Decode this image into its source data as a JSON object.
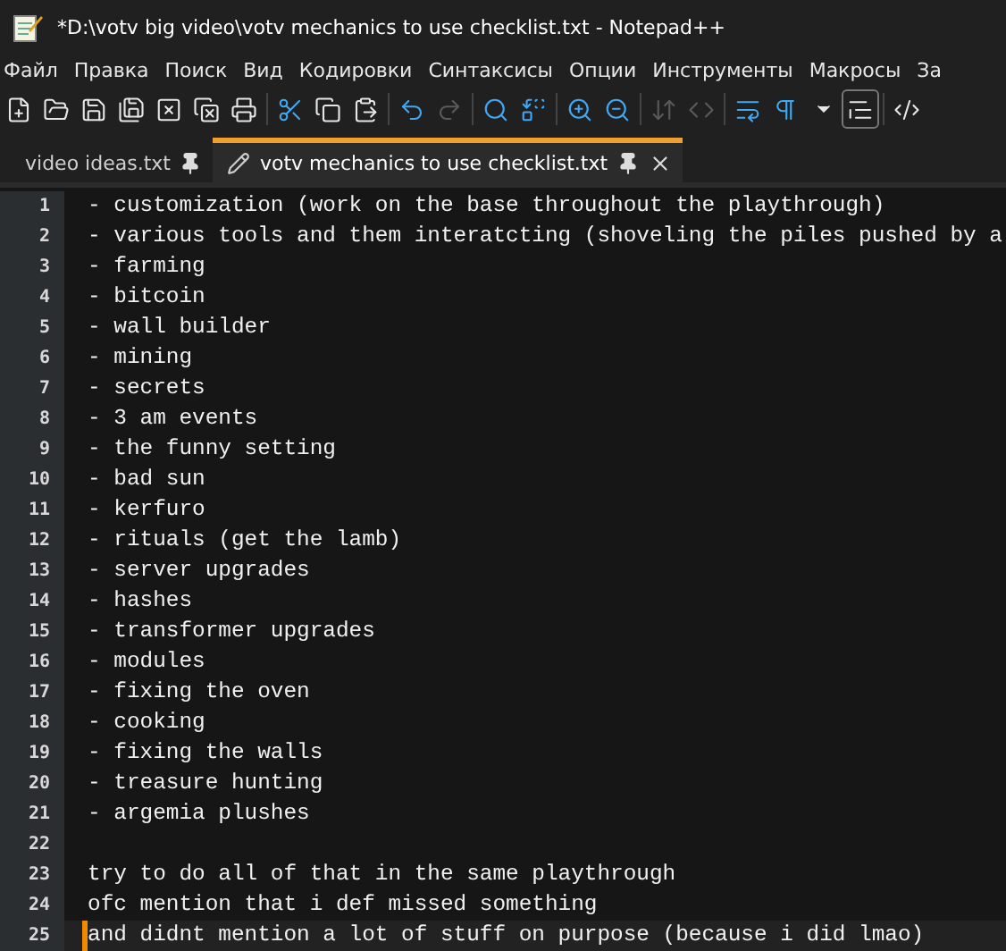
{
  "window": {
    "title": "*D:\\votv big video\\votv mechanics to use checklist.txt - Notepad++"
  },
  "menu": [
    "Файл",
    "Правка",
    "Поиск",
    "Вид",
    "Кодировки",
    "Синтаксисы",
    "Опции",
    "Инструменты",
    "Макросы",
    "За"
  ],
  "toolbar": [
    {
      "disabled": false,
      "selected": false
    },
    {
      "disabled": false,
      "selected": false
    },
    {
      "disabled": false,
      "selected": false
    },
    {
      "disabled": false,
      "selected": false
    },
    {
      "disabled": false,
      "selected": false
    },
    {
      "disabled": false,
      "selected": false
    },
    {
      "disabled": false,
      "selected": false
    },
    {
      "disabled": false,
      "selected": false
    },
    {
      "disabled": false,
      "selected": false
    },
    {
      "disabled": false,
      "selected": false
    },
    {
      "disabled": false,
      "selected": false
    },
    {
      "disabled": true,
      "selected": false
    },
    {
      "disabled": false,
      "selected": false
    },
    {
      "disabled": false,
      "selected": false
    },
    {
      "disabled": false,
      "selected": false
    },
    {
      "disabled": false,
      "selected": false
    },
    {
      "disabled": true,
      "selected": false
    },
    {
      "disabled": true,
      "selected": false
    },
    {
      "disabled": false,
      "selected": false
    },
    {
      "disabled": false,
      "selected": false
    },
    {
      "disabled": false,
      "selected": false
    },
    {
      "disabled": false,
      "selected": true
    },
    {
      "disabled": false,
      "selected": false
    }
  ],
  "tabs": [
    {
      "label": "video ideas.txt",
      "selected": false,
      "modified": false
    },
    {
      "label": "votv mechanics to use checklist.txt",
      "selected": true,
      "modified": true
    }
  ],
  "lines": [
    {
      "number": "1",
      "text": "- customization (work on the base throughout the playthrough)",
      "current": false
    },
    {
      "number": "2",
      "text": "- various tools and them interatcting (shoveling the piles pushed by a",
      "current": false
    },
    {
      "number": "3",
      "text": "- farming",
      "current": false
    },
    {
      "number": "4",
      "text": "- bitcoin",
      "current": false
    },
    {
      "number": "5",
      "text": "- wall builder",
      "current": false
    },
    {
      "number": "6",
      "text": "- mining",
      "current": false
    },
    {
      "number": "7",
      "text": "- secrets",
      "current": false
    },
    {
      "number": "8",
      "text": "- 3 am events",
      "current": false
    },
    {
      "number": "9",
      "text": "- the funny setting",
      "current": false
    },
    {
      "number": "10",
      "text": "- bad sun",
      "current": false
    },
    {
      "number": "11",
      "text": "- kerfuro",
      "current": false
    },
    {
      "number": "12",
      "text": "- rituals (get the lamb)",
      "current": false
    },
    {
      "number": "13",
      "text": "- server upgrades",
      "current": false
    },
    {
      "number": "14",
      "text": "- hashes",
      "current": false
    },
    {
      "number": "15",
      "text": "- transformer upgrades",
      "current": false
    },
    {
      "number": "16",
      "text": "- modules",
      "current": false
    },
    {
      "number": "17",
      "text": "- fixing the oven",
      "current": false
    },
    {
      "number": "18",
      "text": "- cooking",
      "current": false
    },
    {
      "number": "19",
      "text": "- fixing the walls",
      "current": false
    },
    {
      "number": "20",
      "text": "- treasure hunting",
      "current": false
    },
    {
      "number": "21",
      "text": "- argemia plushes",
      "current": false
    },
    {
      "number": "22",
      "current": false
    },
    {
      "number": "23",
      "text": "try to do all of that in the same playthrough",
      "current": false
    },
    {
      "number": "24",
      "text": "ofc mention that i def missed something",
      "current": false
    },
    {
      "number": "25",
      "text": "and didnt mention a lot of stuff on purpose (because i did lmao)",
      "current": true
    }
  ]
}
